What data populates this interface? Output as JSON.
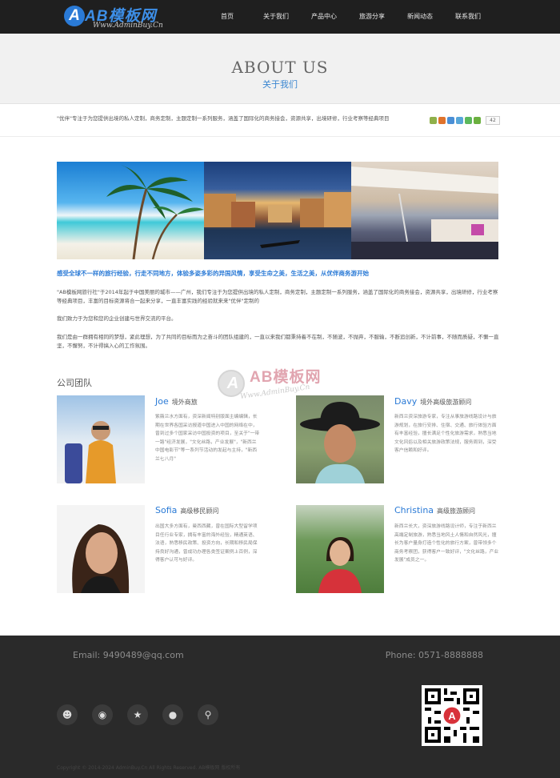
{
  "logo": {
    "title": "AB模板网",
    "subtitle": "Www.AdminBuy.Cn"
  },
  "nav": [
    {
      "label": "首页"
    },
    {
      "label": "关于我们"
    },
    {
      "label": "产品中心"
    },
    {
      "label": "旅游分享"
    },
    {
      "label": "新闻动态"
    },
    {
      "label": "联系我们"
    }
  ],
  "banner": {
    "title": "ABOUT US",
    "subtitle": "关于我们"
  },
  "intro": "\"优伴\"专注于为您提供出境的私人定制，商务定制，主题定制一系列服务，涵盖了国际化的商务接会，资源共享，出境研修，行业考察等经典项目",
  "share": {
    "count": "42",
    "icons": [
      "share-icon",
      "weibo-icon",
      "qzone-icon",
      "tencent-icon",
      "wechat-icon",
      "more-icon"
    ]
  },
  "slogan": "感受全球不一样的旅行经验，行走不同地方，体验多姿多彩的异国风情，享受生命之美，生活之美，从优伴商务游开始",
  "paragraphs": [
    "\"AB模板网旅行社\"于2014年起于中国美丽的城市——广州，我们专注于为您提供出境的私人定制，商务定制，主题定制一系列服务，涵盖了国际化的商务接会，资源共享，出境研修，行业考察等经典项目，丰富的目标资源将合一起来分享，一直丰富实践的经验就来来\"优伴\"定制的",
    "我们致力于为您和您的企业创建与世界交流的平台。",
    "我们是由一群拥有相同的梦想，紧此理想，为了共同的目标而为之奋斗的团队组建的，一直以来我们都秉持着不在制，不随波，不抛弃，不服输，不断追创新，不计前事，不随而质疑，不懈一直坚，不懈努，不计得搞入心的工作氛围。"
  ],
  "section_title": "公司团队",
  "watermark": {
    "title": "AB模板网",
    "subtitle": "Www.AdminBuy.Cn"
  },
  "team": [
    {
      "name": "Joe",
      "role": "境外商旅",
      "bio": "紫薇兰水方面有，资深新闻特别版面主编编辑，长期在世界各国采访报道中国进入中国的网络在中，曾到过多个国家采访中国投资的项目，至关于\"一带一路\"经济发展，\"文化丝路，产业发展\"，\"新西兰中国电影节\"等一系列节活动的发起与主持，\"新西兰七八月\""
    },
    {
      "name": "Davy",
      "role": "境外高级旅游顾问",
      "bio": "新西兰资深旅游专家，专注从事旅游线路设计与旅游规划，在旅行安排、住宿、交通、旅行体验方面有丰富经验，擅长满足个性化旅游需求，熟悉当地文化风俗以及相关旅游政策法规，服务周到，深受客户信赖和好评。"
    },
    {
      "name": "Sofia",
      "role": "高级移民顾问",
      "bio": "出国大多方面有，曼西西藏，曾在国际大型留学项目任行业专家，拥有丰富的海外经验，精通英语、法语，熟悉移民政策、投资方向，长期和移民局保持良好沟通，曾成功办理各类签证案例上百例，深得客户认可与好评。"
    },
    {
      "name": "Christina",
      "role": "高级旅游顾问",
      "bio": "新西兰长大，资深旅游线路设计师，专注于新西兰高端定制旅游，熟悉当地风土人情和自然风光，擅长为客户量身打造个性化的旅行方案，曾带领多个商务考察团，获得客户一致好评，\"文化丝路，产业发展\"成员之一。"
    }
  ],
  "footer": {
    "email": "Email: 9490489@qq.com",
    "phone": "Phone: 0571-8888888",
    "icons": [
      "qq-icon",
      "weibo-icon",
      "star-icon",
      "wechat-icon",
      "tencent-weibo-icon"
    ],
    "copyright": "Copyright © 2014-2024 AdminBuy.Cn All Rights Reserved. AB模板网 版权所有"
  }
}
